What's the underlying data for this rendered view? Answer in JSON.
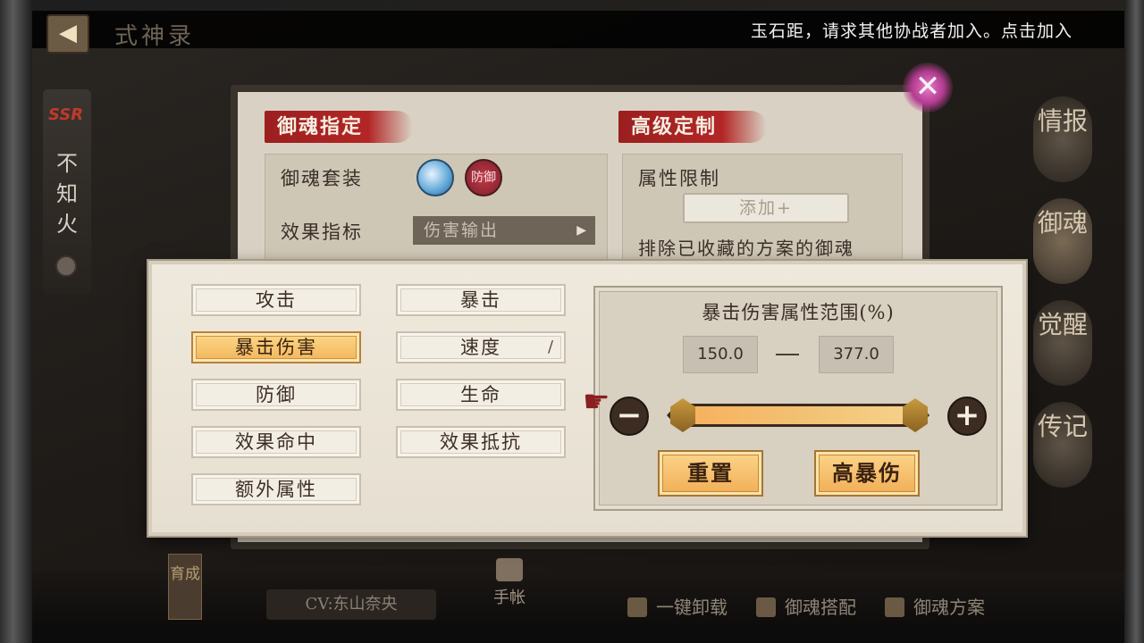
{
  "header": {
    "title": "式神录",
    "back_icon": "◀",
    "marquee": "玉石距，请求其他协战者加入。点击加入"
  },
  "character": {
    "rarity": "SSR",
    "name": "不知火"
  },
  "side_tabs": [
    "情报",
    "御魂",
    "觉醒",
    "传记"
  ],
  "back_panel": {
    "section_left_title": "御魂指定",
    "section_right_title": "高级定制",
    "set_label": "御魂套装",
    "set_icon_2_text": "防御",
    "metric_label": "效果指标",
    "metric_value": "伤害输出",
    "metric_arrow": "▶",
    "attr_limit_label": "属性限制",
    "add_button": "添加+",
    "exclude_label": "排除已收藏的方案的御魂",
    "close_icon": "✕"
  },
  "attribute_selector": {
    "left_column": [
      "攻击",
      "暴击伤害",
      "防御",
      "效果命中",
      "额外属性"
    ],
    "right_column": [
      "暴击",
      "速度",
      "生命",
      "效果抵抗"
    ],
    "selected": "暴击伤害",
    "brush_icon": "/"
  },
  "range": {
    "title": "暴击伤害属性范围(%)",
    "min_value": "150.0",
    "max_value": "377.0",
    "minus": "−",
    "plus": "+",
    "reset_button": "重置",
    "preset_button": "高暴伤"
  },
  "bottom": {
    "cv": "CV:东山奈央",
    "nurture": "育成",
    "handbook": "手帐",
    "unload_all": "一键卸载",
    "match": "御魂搭配",
    "plans": "御魂方案"
  },
  "colors": {
    "accent_red": "#b32626",
    "selected_gold": "#f3b45a",
    "panel_bg": "#efe9dd"
  }
}
